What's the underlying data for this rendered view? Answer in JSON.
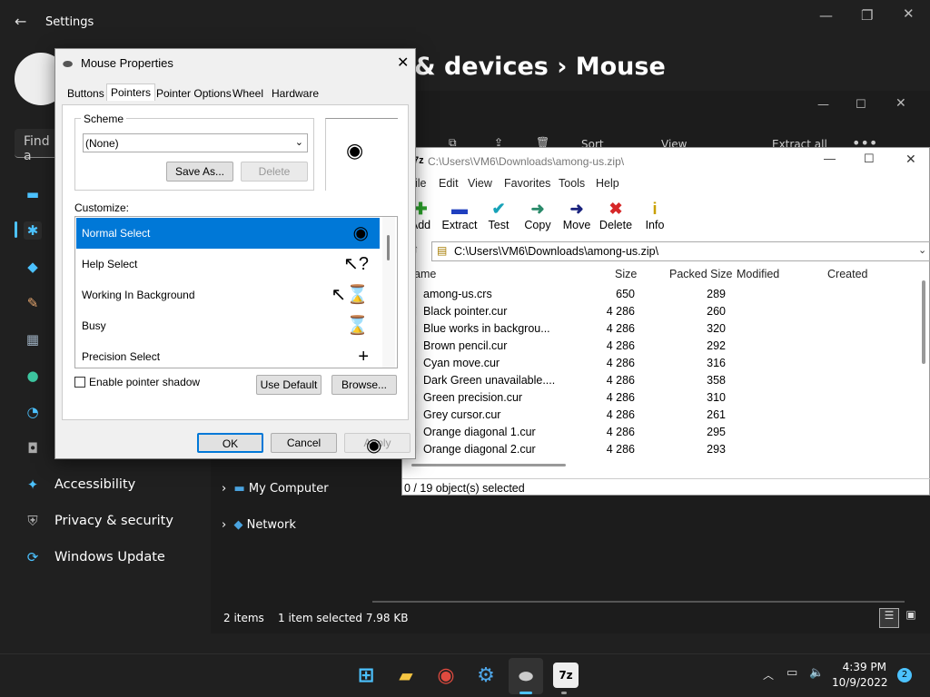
{
  "settings": {
    "title": "Settings",
    "find": "Find a",
    "heading": "& devices  ›  Mouse",
    "nav": [
      "Accessibility",
      "Privacy & security",
      "Windows Update"
    ]
  },
  "explorer": {
    "toolbar": {
      "sort": "Sort",
      "view": "View",
      "extract": "Extract all"
    },
    "tree": [
      "My Computer",
      "Network"
    ],
    "status": {
      "items": "2 items",
      "selected": "1 item selected  7.98 KB"
    }
  },
  "zip": {
    "title": "C:\\Users\\VM6\\Downloads\\among-us.zip\\",
    "menu": [
      "ile",
      "Edit",
      "View",
      "Favorites",
      "Tools",
      "Help"
    ],
    "tools": [
      {
        "label": "Add",
        "icon": "+",
        "color": "#2ca02c"
      },
      {
        "label": "Extract",
        "icon": "▬",
        "color": "#1f3fbf"
      },
      {
        "label": "Test",
        "icon": "✔",
        "color": "#17a2b8"
      },
      {
        "label": "Copy",
        "icon": "➜",
        "color": "#2a8a6a"
      },
      {
        "label": "Move",
        "icon": "➜",
        "color": "#1a237e"
      },
      {
        "label": "Delete",
        "icon": "✖",
        "color": "#d62728"
      },
      {
        "label": "Info",
        "icon": "i",
        "color": "#c9a000"
      }
    ],
    "address": "C:\\Users\\VM6\\Downloads\\among-us.zip\\",
    "columns": [
      "Name",
      "Size",
      "Packed Size",
      "Modified",
      "Created"
    ],
    "rows": [
      [
        "among-us.crs",
        "650",
        "289"
      ],
      [
        "Black pointer.cur",
        "4 286",
        "260"
      ],
      [
        "Blue works in backgrou...",
        "4 286",
        "320"
      ],
      [
        "Brown pencil.cur",
        "4 286",
        "292"
      ],
      [
        "Cyan move.cur",
        "4 286",
        "316"
      ],
      [
        "Dark Green unavailable....",
        "4 286",
        "358"
      ],
      [
        "Green precision.cur",
        "4 286",
        "310"
      ],
      [
        "Grey cursor.cur",
        "4 286",
        "261"
      ],
      [
        "Orange diagonal 1.cur",
        "4 286",
        "295"
      ],
      [
        "Orange diagonal 2.cur",
        "4 286",
        "293"
      ]
    ],
    "status": "0 / 19 object(s) selected"
  },
  "dialog": {
    "title": "Mouse Properties",
    "tabs": [
      "Buttons",
      "Pointers",
      "Pointer Options",
      "Wheel",
      "Hardware"
    ],
    "scheme_label": "Scheme",
    "scheme_value": "(None)",
    "save_as": "Save As...",
    "delete": "Delete",
    "customize": "Customize:",
    "pointers": [
      {
        "name": "Normal Select",
        "cur": "◉"
      },
      {
        "name": "Help Select",
        "cur": "↖?"
      },
      {
        "name": "Working In Background",
        "cur": "↖⌛"
      },
      {
        "name": "Busy",
        "cur": "⌛"
      },
      {
        "name": "Precision Select",
        "cur": "+"
      }
    ],
    "shadow": "Enable pointer shadow",
    "use_default": "Use Default",
    "browse": "Browse...",
    "ok": "OK",
    "cancel": "Cancel",
    "apply": "Apply"
  },
  "taskbar": {
    "time": "4:39 PM",
    "date": "10/9/2022",
    "badge": "2"
  }
}
